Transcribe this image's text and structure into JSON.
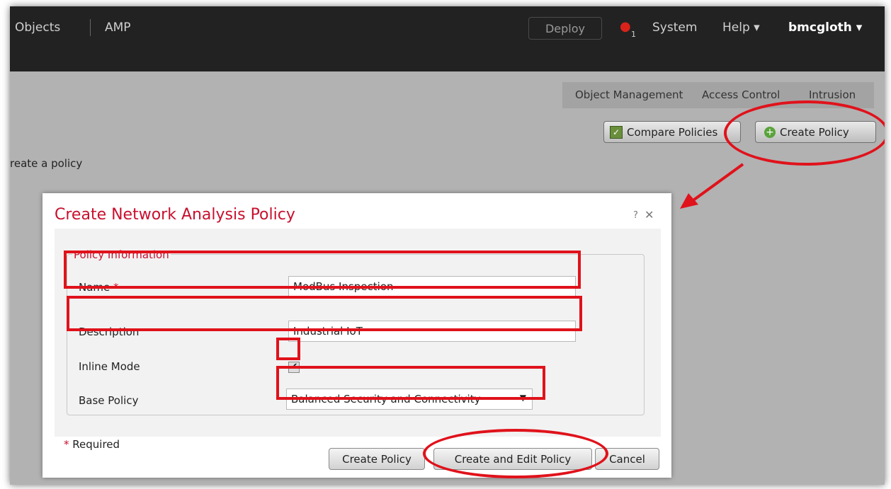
{
  "topbar": {
    "objects_label": "Objects",
    "amp_label": "AMP",
    "deploy_label": "Deploy",
    "alert_count": "1",
    "system_label": "System",
    "help_label": "Help ▾",
    "user_label": "bmcgloth ▾"
  },
  "subnav": {
    "items": [
      "Object Management",
      "Access Control",
      "Intrusion"
    ]
  },
  "toolbar": {
    "compare_label": "Compare Policies",
    "create_label": "Create Policy"
  },
  "page": {
    "create_text": "reate a policy"
  },
  "modal": {
    "title": "Create Network Analysis Policy",
    "help": "?",
    "close": "✕",
    "legend": "Policy Information",
    "name_label": "Name",
    "required_star": "*",
    "name_value": "ModBus Inspection",
    "description_label": "Description",
    "description_value": "Industrial IoT",
    "inline_mode_label": "Inline Mode",
    "inline_mode_checked": true,
    "base_policy_label": "Base Policy",
    "base_policy_value": "Balanced Security and Connectivity",
    "required_note": "Required",
    "create_button": "Create Policy",
    "create_edit_button": "Create and Edit Policy",
    "cancel_button": "Cancel"
  },
  "colors": {
    "annotation": "#e0121b",
    "title": "#c8102e",
    "topbar": "#222222",
    "backdrop": "#b2b2b2"
  }
}
